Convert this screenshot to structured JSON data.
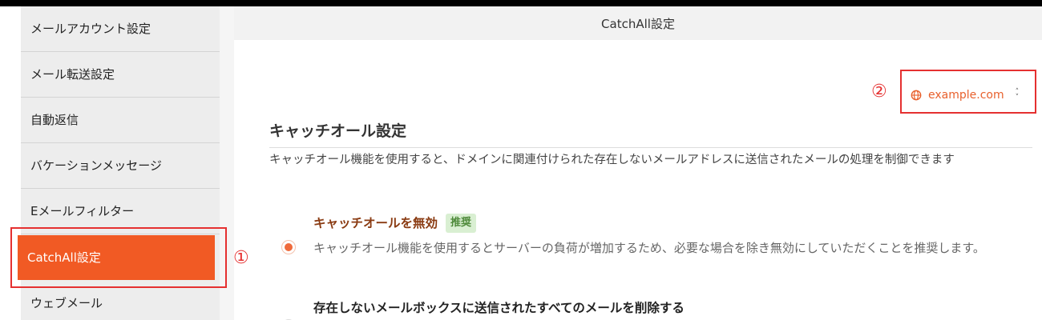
{
  "sidebar": {
    "items": [
      {
        "label": "メールアカウント設定"
      },
      {
        "label": "メール転送設定"
      },
      {
        "label": "自動返信"
      },
      {
        "label": "バケーションメッセージ"
      },
      {
        "label": "Eメールフィルター"
      },
      {
        "label": "CatchAll設定",
        "active": true
      },
      {
        "label": "ウェブメール"
      }
    ]
  },
  "header": {
    "title": "CatchAll設定"
  },
  "domain_select": {
    "value": "example.com",
    "icon": "globe-icon"
  },
  "section": {
    "title": "キャッチオール設定",
    "description": "キャッチオール機能を使用すると、ドメインに関連付けられた存在しないメールアドレスに送信されたメールの処理を制御できます"
  },
  "options": [
    {
      "title": "キャッチオールを無効",
      "badge": "推奨",
      "description": "キャッチオール機能を使用するとサーバーの負荷が増加するため、必要な場合を除き無効にしていただくことを推奨します。",
      "checked": true
    },
    {
      "title": "存在しないメールボックスに送信されたすべてのメールを削除する",
      "checked": false
    }
  ],
  "annotations": {
    "marker1": "①",
    "marker2": "②"
  },
  "colors": {
    "accent": "#f15a24",
    "annotation": "#e53030",
    "badge_bg": "#d9efd2",
    "option_title": "#8a3b12"
  }
}
